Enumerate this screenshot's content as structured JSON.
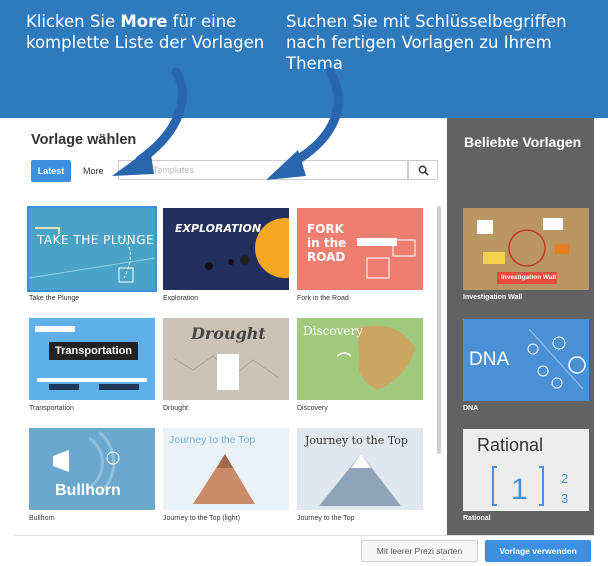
{
  "callouts": {
    "left_prefix": "Klicken Sie ",
    "left_bold": "More",
    "left_suffix": " für eine komplette Liste der Vorlagen",
    "right": "Suchen Sie mit Schlüsselbegriffen nach fertigen Vorlagen zu Ihrem Thema"
  },
  "dialog": {
    "title": "Vorlage wählen",
    "tabs": {
      "latest": "Latest",
      "more": "More"
    },
    "search": {
      "placeholder": "Search for Templates",
      "visible_text": "rch for Templates"
    },
    "templates": [
      {
        "label": "Take the Plunge",
        "art": "TAKE THE PLUNGE"
      },
      {
        "label": "Exploration",
        "art": "EXPLORATION"
      },
      {
        "label": "Fork in the Road",
        "art": "FORK in the ROAD"
      },
      {
        "label": "Transportation",
        "art": "Transportation"
      },
      {
        "label": "Drought",
        "art": "Drought"
      },
      {
        "label": "Discovery",
        "art": "Discovery"
      },
      {
        "label": "Bullhorn",
        "art": "Bullhorn"
      },
      {
        "label": "Journey to the Top (light)",
        "art": "Journey to the Top"
      },
      {
        "label": "Journey to the Top",
        "art": "Journey to the Top"
      }
    ]
  },
  "sidebar": {
    "title": "Beliebte Vorlagen",
    "templates": [
      {
        "label": "Investigation Wall",
        "art": "Investigation Wall"
      },
      {
        "label": "DNA",
        "art": "DNA"
      },
      {
        "label": "Rational",
        "art": "Rational"
      }
    ]
  },
  "footer": {
    "empty_button": "Mit leerer Prezi starten",
    "use_button": "Vorlage verwenden"
  },
  "colors": {
    "banner": "#2f79bd",
    "accent": "#3d8fe0",
    "sidebar": "#626262"
  },
  "icons": [
    "search-icon",
    "arrow-icon"
  ]
}
